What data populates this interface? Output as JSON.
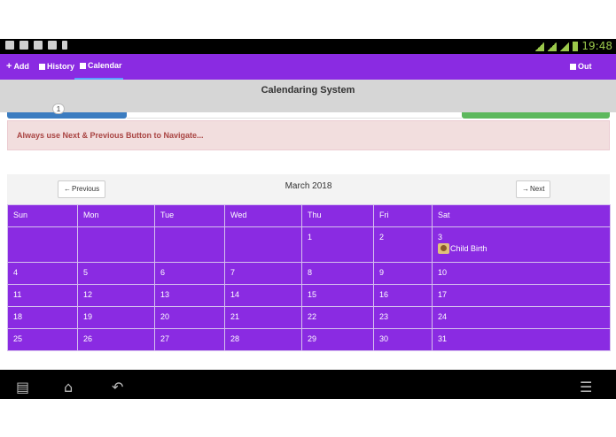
{
  "status_bar": {
    "time": "19:48"
  },
  "navbar": {
    "items": [
      {
        "label": "Add",
        "icon": "plus-icon"
      },
      {
        "label": "History",
        "icon": "history-icon"
      },
      {
        "label": "Calendar",
        "icon": "calendar-icon",
        "active": true
      },
      {
        "label": "Out",
        "icon": "logout-icon"
      }
    ]
  },
  "header": {
    "title": "Calendaring System"
  },
  "progress": {
    "step": "1"
  },
  "alert": {
    "text": "Always use Next & Previous Button to Navigate..."
  },
  "calendar": {
    "month_title": "March 2018",
    "prev_label": "Previous",
    "next_label": "Next",
    "weekdays": [
      "Sun",
      "Mon",
      "Tue",
      "Wed",
      "Thu",
      "Fri",
      "Sat"
    ],
    "weeks": [
      [
        "",
        "",
        "",
        "",
        "1",
        "2",
        "3"
      ],
      [
        "4",
        "5",
        "6",
        "7",
        "8",
        "9",
        "10"
      ],
      [
        "11",
        "12",
        "13",
        "14",
        "15",
        "16",
        "17"
      ],
      [
        "18",
        "19",
        "20",
        "21",
        "22",
        "23",
        "24"
      ],
      [
        "25",
        "26",
        "27",
        "28",
        "29",
        "30",
        "31"
      ]
    ],
    "event": {
      "label": "Child Birth"
    }
  },
  "colors": {
    "primary": "#8a2be2",
    "alert_text": "#a94442",
    "alert_bg": "#f2dede"
  }
}
